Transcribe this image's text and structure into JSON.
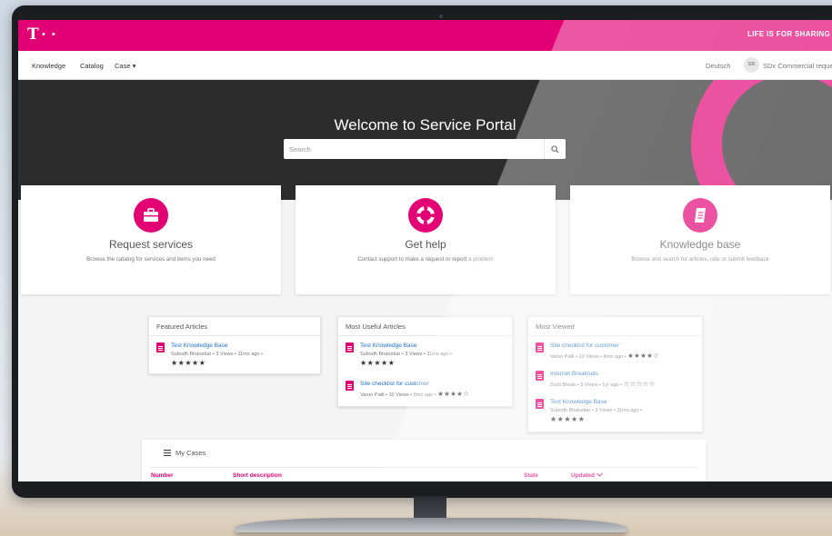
{
  "colors": {
    "brand": "#e20074",
    "link": "#1e6fc8",
    "hero": "#2c2c2c"
  },
  "topbar": {
    "logo": "T",
    "logo_dots": "• •",
    "slogan": "LIFE IS FOR SHARING"
  },
  "nav": {
    "items": [
      "Knowledge",
      "Catalog",
      "Case ▾"
    ],
    "language": "Deutsch",
    "avatar_initials": "SR",
    "user_name": "SDx Commercial request"
  },
  "hero": {
    "title": "Welcome to Service Portal",
    "search_placeholder": "Search"
  },
  "tiles": [
    {
      "title": "Request services",
      "desc": "Browse the catalog for services and items you need",
      "icon": "briefcase-icon"
    },
    {
      "title": "Get help",
      "desc": "Contact support to make a request or report a problem",
      "icon": "lifebuoy-icon"
    },
    {
      "title": "Knowledge base",
      "desc": "Browse and search for articles, rate or submit feedback",
      "icon": "book-icon"
    }
  ],
  "featured": {
    "title": "Featured Articles",
    "articles": [
      {
        "title": "Test Knowledge Base",
        "meta": "Subodh Bhaturkar • 3 Views • 11mo ago •",
        "stars": "★★★★★"
      }
    ]
  },
  "useful": {
    "title": "Most Useful Articles",
    "articles": [
      {
        "title": "Test Knowledge Base",
        "meta": "Subodh Bhaturkar • 3 Views • 11mo ago •",
        "stars": "★★★★★"
      },
      {
        "title": "Site checklist for customer",
        "meta": "Varun Patil • 10 Views • 8mo ago •",
        "stars": "★★★★☆"
      }
    ]
  },
  "viewed": {
    "title": "Most Viewed",
    "articles": [
      {
        "title": "Site checklist for customer",
        "meta": "Varun Patil • 10 Views • 8mo ago •",
        "stars": "★★★★☆"
      },
      {
        "title": "Internet Breakouts",
        "meta": "Zsolt Biesik • 3 Views • 1yr ago •",
        "stars": "☆☆☆☆☆"
      },
      {
        "title": "Test Knowledge Base",
        "meta": "Subodh Bhaturkar • 3 Views • 11mo ago •",
        "stars": "★★★★★"
      }
    ]
  },
  "cases": {
    "title": "My Cases",
    "columns": [
      "Number",
      "Short description",
      "State",
      "Updated"
    ]
  }
}
